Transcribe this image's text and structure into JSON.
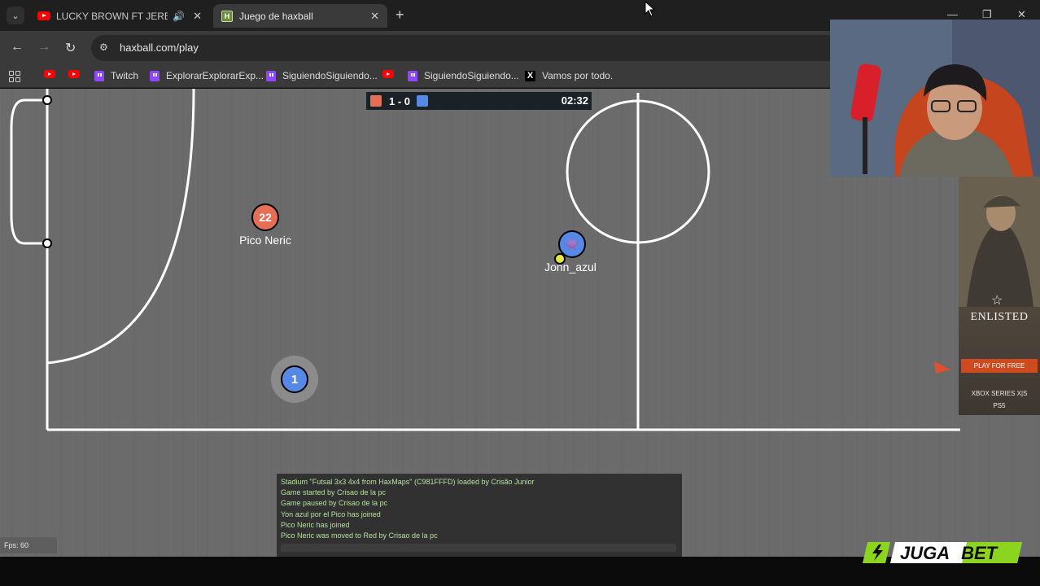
{
  "browser": {
    "tabs": [
      {
        "title": "LUCKY BROWN FT JERE KLEIN",
        "favicon": "youtube-icon",
        "audio": true,
        "active": false
      },
      {
        "title": "Juego de haxball",
        "favicon": "haxball-icon",
        "active": true
      }
    ],
    "url": "haxball.com/play",
    "bookmarks": [
      {
        "label": "",
        "icon": "youtube-icon"
      },
      {
        "label": "",
        "icon": "youtube-icon"
      },
      {
        "label": "Twitch",
        "icon": "twitch-icon"
      },
      {
        "label": "ExplorarExplorarExp...",
        "icon": "twitch-icon"
      },
      {
        "label": "SiguiendoSiguiendo...",
        "icon": "twitch-icon"
      },
      {
        "label": "",
        "icon": "youtube-icon"
      },
      {
        "label": "SiguiendoSiguiendo...",
        "icon": "twitch-icon"
      },
      {
        "label": "Vamos por todo.",
        "icon": "x-icon"
      }
    ]
  },
  "game": {
    "score": "1 - 0",
    "timer": "02:32",
    "colors": {
      "red": "#e56e56",
      "blue": "#5689e5",
      "pitch": "#6b6b6b",
      "chat_text": "#b9e6a0"
    },
    "players": [
      {
        "team": "red",
        "avatar": "22",
        "name": "Pico Neric"
      },
      {
        "team": "blue",
        "avatar": "👾",
        "name": "Jonn_azul"
      },
      {
        "team": "blue",
        "avatar": "1",
        "name": ""
      }
    ],
    "chat": [
      "Stadium \"Futsal 3x3 4x4 from HaxMaps\" (C981FFFD) loaded by Crisão Junior",
      "Game started by Crisao de la pc",
      "Game paused by Crisao de la pc",
      "Yon azul por el Pico has joined",
      "Pico Neric has joined",
      "Pico Neric was moved to Red by Crisao de la pc"
    ],
    "fps": "Fps: 60"
  },
  "ad": {
    "title": "ENLISTED",
    "cta": "PLAY FOR FREE",
    "platforms": [
      "XBOX SERIES X|S",
      "PS5"
    ]
  },
  "sponsor": "JUGABET"
}
